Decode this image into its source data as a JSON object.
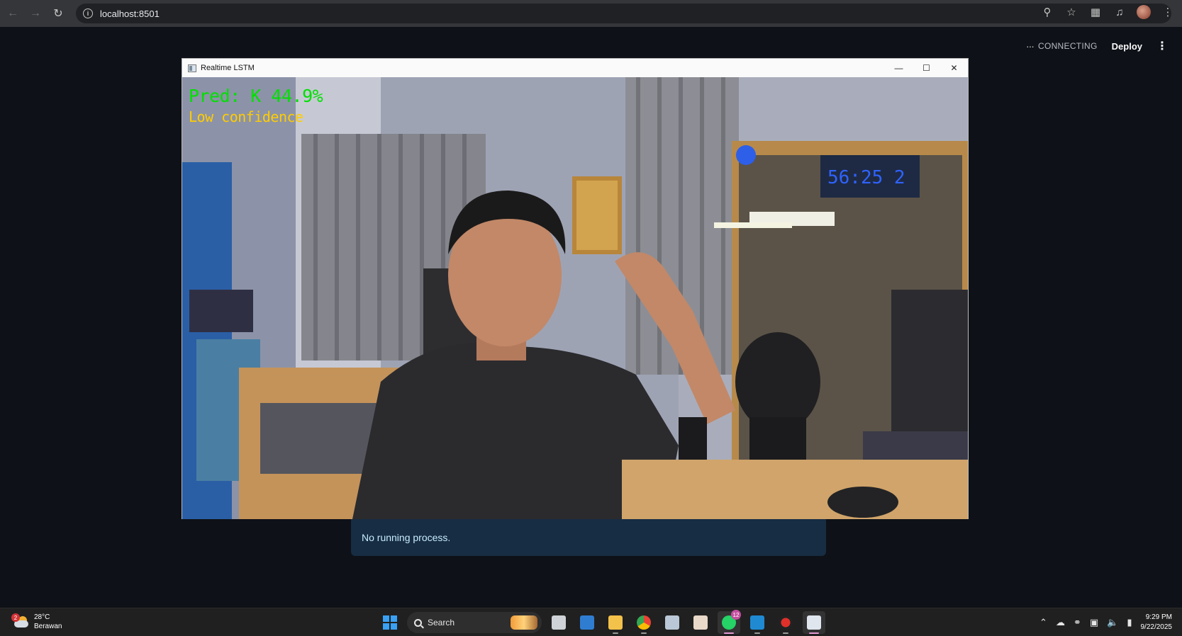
{
  "browser": {
    "url": "localhost:8501"
  },
  "streamlit": {
    "status": "CONNECTING",
    "deploy_label": "Deploy"
  },
  "cv_window": {
    "title": "Realtime LSTM",
    "prediction_text": "Pred: K 44.9%",
    "confidence_text": "Low confidence",
    "prediction_color": "#00e000",
    "confidence_color": "#ffcc00"
  },
  "info_box": {
    "message": "No running process."
  },
  "taskbar": {
    "weather": {
      "badge": "2",
      "temperature": "28°C",
      "condition": "Berawan"
    },
    "search_placeholder": "Search",
    "whatsapp_badge": "12",
    "apps": [
      "task-view",
      "photos",
      "file-explorer",
      "chrome",
      "notepad",
      "anime-app",
      "whatsapp",
      "vscode",
      "obs",
      "opencv-window"
    ],
    "time": "9:29 PM",
    "date": "9/22/2025"
  },
  "colors": {
    "page_bg": "#0e1117",
    "info_bg": "#172d43",
    "info_text": "#c7ebff",
    "accent": "#3aa0f3"
  }
}
